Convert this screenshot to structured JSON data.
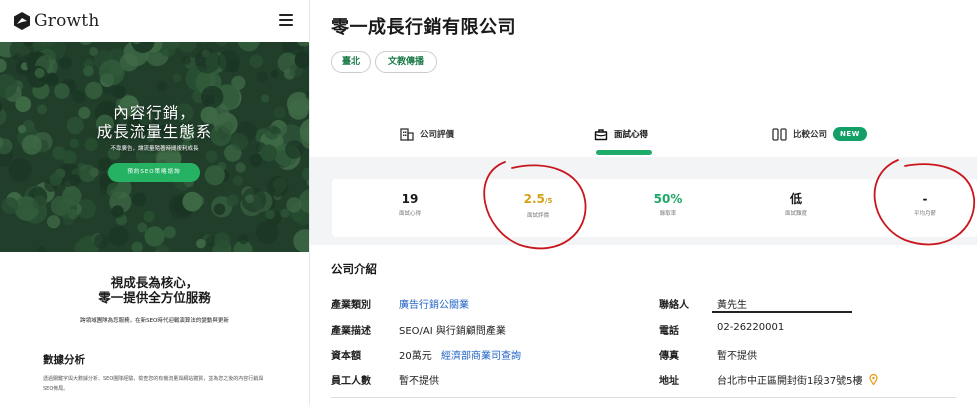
{
  "brand": {
    "name": "Growth"
  },
  "hero": {
    "title_line1": "內容行銷，",
    "title_line2": "成長流量生態系",
    "subtitle": "不靠廣告，讓流量隨著時間複利成長",
    "cta": "預約SEO策略諮詢"
  },
  "section1": {
    "title_line1": "視成長為核心，",
    "title_line2": "零一提供全方位服務",
    "subtitle": "跨領域團隊為您服務，在新SEO時代迎戰演算法的變動與更新"
  },
  "section2": {
    "title": "數據分析",
    "text": "透過關鍵字與大數據分析、SEO團隊經驗，檢查您的有機流量與網站體質，並為您之後的內容行銷與SEO佈局。"
  },
  "company": {
    "name": "零一成長行銷有限公司",
    "tags": [
      "臺北",
      "文教傳播"
    ]
  },
  "tabs": [
    {
      "label": "公司評價"
    },
    {
      "label": "面試心得"
    },
    {
      "label": "比較公司",
      "badge": "NEW"
    }
  ],
  "stats": [
    {
      "value": "19",
      "label": "面試心得"
    },
    {
      "value": "2.5",
      "suffix": "/5",
      "label": "面試評價"
    },
    {
      "value": "50%",
      "label": "錄取率"
    },
    {
      "value": "低",
      "label": "面試難度"
    },
    {
      "value": "-",
      "label": "平均月薪"
    }
  ],
  "intro": {
    "title": "公司介紹",
    "industry_label": "產業類別",
    "industry_value": "廣告行銷公關業",
    "desc_label": "產業描述",
    "desc_value": "SEO/AI 與行銷顧問產業",
    "capital_label": "資本額",
    "capital_value": "20萬元",
    "capital_link": "經濟部商業司查詢",
    "employees_label": "員工人數",
    "employees_value": "暫不提供",
    "contact_label": "聯絡人",
    "contact_value": "黃先生",
    "phone_label": "電話",
    "phone_value": "02-26220001",
    "fax_label": "傳真",
    "fax_value": "暫不提供",
    "address_label": "地址",
    "address_value": "台北市中正區開封街1段37號5樓"
  },
  "colors": {
    "accent": "#1fab69",
    "link": "#1f62c4",
    "rating": "#d4a216",
    "annotation": "#c8161d"
  }
}
